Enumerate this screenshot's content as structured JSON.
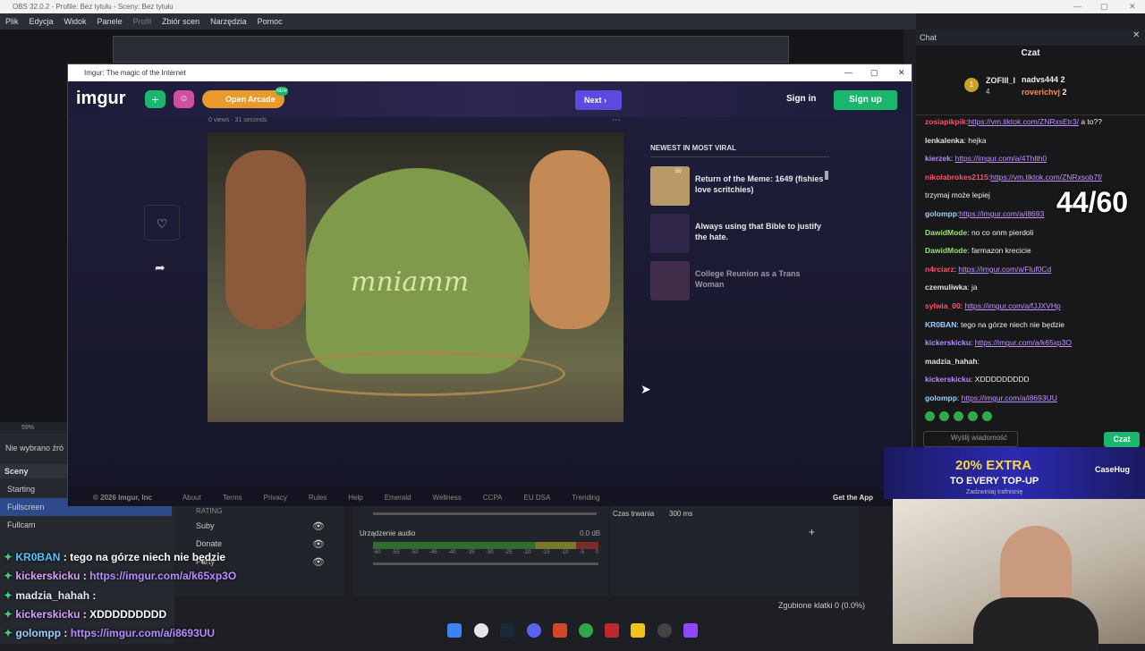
{
  "obs": {
    "title": "OBS 32.0.2 - Profile: Bez tytułu - Sceny: Bez tytułu",
    "menu": [
      "Plik",
      "Edycja",
      "Widok",
      "Panele",
      "Profil",
      "Zbiór scen",
      "Narzędzia",
      "Pomoc"
    ],
    "no_source": "Nie wybrano źró",
    "zoom": "59%",
    "scenes_header": "Sceny",
    "scenes": [
      "Starting",
      "Fullscreen",
      "Fullcam"
    ],
    "sources": [
      "RATING",
      "Suby",
      "Donate",
      "Party"
    ],
    "audio_label": "Urządzenie audio",
    "db_value": "0.0 dB",
    "db_ticks": [
      "-60",
      "-55",
      "-50",
      "-45",
      "-40",
      "-35",
      "-30",
      "-25",
      "-20",
      "-15",
      "-10",
      "-5",
      "0"
    ],
    "duration_label": "Czas trwania",
    "duration_value": "300 ms",
    "dropped_frames": "Zgubione klatki 0 (0.0%)"
  },
  "imgur": {
    "window_title": "Imgur: The magic of the Internet",
    "logo": "imgur",
    "open_arcade": "Open Arcade",
    "arcade_badge": "NEW",
    "next": "Next",
    "sign_in": "Sign in",
    "sign_up": "Sign up",
    "post_meta": "0 views  ·  31 seconds",
    "image_text": "mniamm",
    "sidebar_title": "NEWEST IN MOST VIRAL",
    "sidebar_posts": [
      {
        "title": "Return of the Meme: 1649 (fishies love scritchies)",
        "badge": "50"
      },
      {
        "title": "Always using that Bible to justify the hate."
      },
      {
        "title": "College Reunion as a Trans Woman"
      }
    ],
    "footer": [
      "© 2026 Imgur, Inc",
      "About",
      "Terms",
      "Privacy",
      "Rules",
      "Help",
      "Emerald",
      "Wellness",
      "CCPA",
      "EU DSA",
      "Trending"
    ],
    "get_app": "Get the App"
  },
  "chat": {
    "panel_title": "Chat",
    "header": "Czat",
    "top_user": "ZOFIII_I",
    "top_user_count": "4",
    "leaders": [
      {
        "name": "nadvs444",
        "count": "2"
      },
      {
        "name": "roverichvj",
        "count": "2"
      }
    ],
    "counter": "44/60",
    "messages": [
      {
        "user": "zosiapikpik",
        "color": "#ff4f6a",
        "text": "",
        "link": "https://vm.tiktok.com/ZNRxsEtr3/",
        "after": " a to??"
      },
      {
        "user": "lenkalenka",
        "color": "#e0e0e0",
        "text": " hejka",
        "link": "",
        "after": ""
      },
      {
        "user": "kierzek",
        "color": "#b58cff",
        "text": " ",
        "link": "https://imgur.com/a/4Thlth0",
        "after": ""
      },
      {
        "user": "nikolabrokes2115",
        "color": "#ff4f6a",
        "text": "",
        "link": "https://vm.tiktok.com/ZNRxsob7f/",
        "after": ""
      },
      {
        "user": "",
        "color": "#e0e0e0",
        "text": "trzymaj może lepiej",
        "link": "",
        "after": ""
      },
      {
        "user": "golompp",
        "color": "#9ad0ff",
        "text": "",
        "link": "https://imgur.com/a/i8693",
        "after": ""
      },
      {
        "user": "DawidMode",
        "color": "#9be26a",
        "text": " no co onm pierdoli",
        "link": "",
        "after": ""
      },
      {
        "user": "DawidMode",
        "color": "#9be26a",
        "text": " farmazon krecicie",
        "link": "",
        "after": ""
      },
      {
        "user": "n4rciarz",
        "color": "#ff4f6a",
        "text": " ",
        "link": "https://imgur.com/a/Fluf0Cd",
        "after": ""
      },
      {
        "user": "czemuliwka",
        "color": "#e0e0e0",
        "text": " ja",
        "link": "",
        "after": ""
      },
      {
        "user": "sylwia_00",
        "color": "#ff4f6a",
        "text": " ",
        "link": "https://imgur.com/a/fJJXVHp",
        "after": ""
      },
      {
        "user": "KR0BAN",
        "color": "#9ad0ff",
        "text": " tego na górze niech nie będzie",
        "link": "",
        "after": ""
      },
      {
        "user": "kickerskicku",
        "color": "#b58cff",
        "text": " ",
        "link": "https://imgur.com/a/k65xp3O",
        "after": ""
      },
      {
        "user": "madzia_hahah",
        "color": "#e0e0e0",
        "text": "",
        "link": "",
        "after": ""
      },
      {
        "user": "kickerskicku",
        "color": "#b58cff",
        "text": " XDDDDDDDDD",
        "link": "",
        "after": ""
      },
      {
        "user": "golompp",
        "color": "#9ad0ff",
        "text": " ",
        "link": "https://imgur.com/a/i8693UU",
        "after": ""
      }
    ],
    "input_placeholder": "Wyślij wiadomość",
    "send_button": "Czat"
  },
  "promo": {
    "text": "20% EXTRA",
    "sub": "TO EVERY TOP-UP",
    "brand": "CaseHug",
    "small": "Zadzwiniaj trafnisnię"
  },
  "overlay_chat": [
    {
      "user": "KR0BAN",
      "color": "#4fc3ff",
      "text": " : tego na górze niech nie będzie",
      "link": ""
    },
    {
      "user": "kickerskicku",
      "color": "#d7a0ff",
      "text": " : ",
      "link": "https://imgur.com/a/k65xp3O"
    },
    {
      "user": "madzia_hahah",
      "color": "#e6e6ff",
      "text": " : ",
      "link": ""
    },
    {
      "user": "kickerskicku",
      "color": "#d7a0ff",
      "text": " : XDDDDDDDDD",
      "link": ""
    },
    {
      "user": "golompp",
      "color": "#9ad0ff",
      "text": " : ",
      "link": "https://imgur.com/a/i8693UU"
    }
  ],
  "colors": {
    "imgur_green": "#1bb76e",
    "imgur_purple": "#5b4be0",
    "arcade": "#e99a2b",
    "twitch": "#9147ff",
    "chat_bg": "#18181b"
  }
}
